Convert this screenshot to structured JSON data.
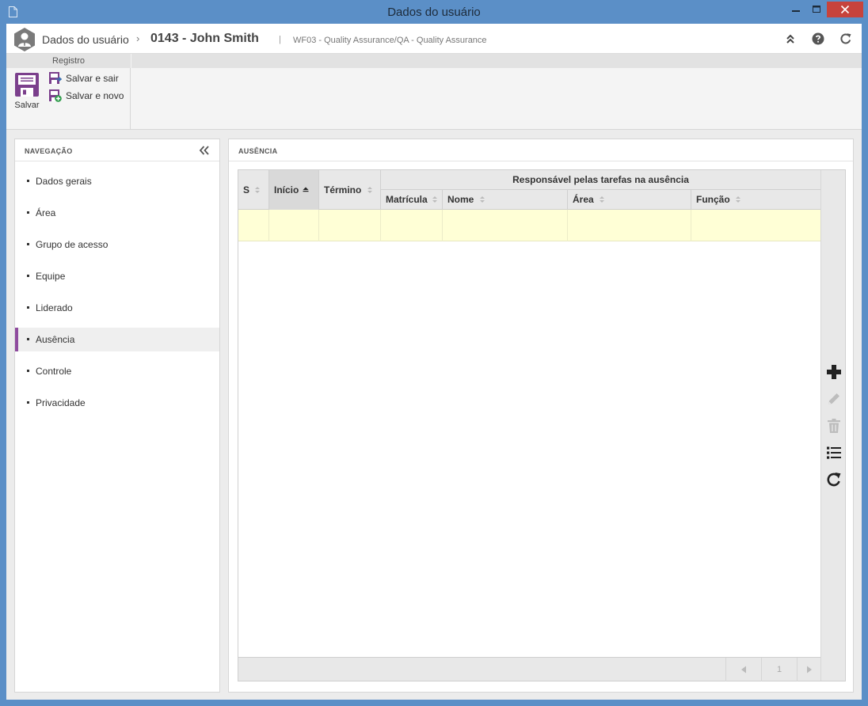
{
  "window": {
    "title": "Dados do usuário"
  },
  "header": {
    "breadcrumb_root": "Dados do usuário",
    "breadcrumb_separator": "›",
    "record_title": "0143 - John Smith",
    "pipe": "|",
    "subtitle": "WF03 - Quality Assurance/QA - Quality Assurance",
    "icons": [
      "collapse-up-icon",
      "help-icon",
      "refresh-icon"
    ]
  },
  "ribbon": {
    "group_label": "Registro",
    "save_label": "Salvar",
    "save_exit_label": "Salvar e sair",
    "save_new_label": "Salvar e novo",
    "accent_color": "#7b3f8c"
  },
  "navigation": {
    "title": "NAVEGAÇÃO",
    "items": [
      {
        "label": "Dados gerais",
        "active": false
      },
      {
        "label": "Área",
        "active": false
      },
      {
        "label": "Grupo de acesso",
        "active": false
      },
      {
        "label": "Equipe",
        "active": false
      },
      {
        "label": "Liderado",
        "active": false
      },
      {
        "label": "Ausência",
        "active": true
      },
      {
        "label": "Controle",
        "active": false
      },
      {
        "label": "Privacidade",
        "active": false
      }
    ],
    "active_color": "#8e4b9e"
  },
  "content": {
    "title": "AUSÊNCIA",
    "grid": {
      "columns": [
        {
          "label": "S",
          "sort": "none"
        },
        {
          "label": "Início",
          "sort": "asc"
        },
        {
          "label": "Término",
          "sort": "none"
        }
      ],
      "group_header": "Responsável pelas tarefas na ausência",
      "group_columns": [
        {
          "label": "Matrícula",
          "sort": "none"
        },
        {
          "label": "Nome",
          "sort": "none"
        },
        {
          "label": "Área",
          "sort": "none"
        },
        {
          "label": "Função",
          "sort": "none"
        }
      ],
      "rows": [
        {
          "S": "",
          "Início": "",
          "Término": "",
          "Matrícula": "",
          "Nome": "",
          "Área": "",
          "Função": ""
        }
      ],
      "pager": {
        "page": "1"
      },
      "selected_row_color": "#ffffd6"
    },
    "side_actions": [
      "add-icon",
      "edit-icon",
      "delete-icon",
      "list-icon",
      "refresh-icon"
    ]
  }
}
